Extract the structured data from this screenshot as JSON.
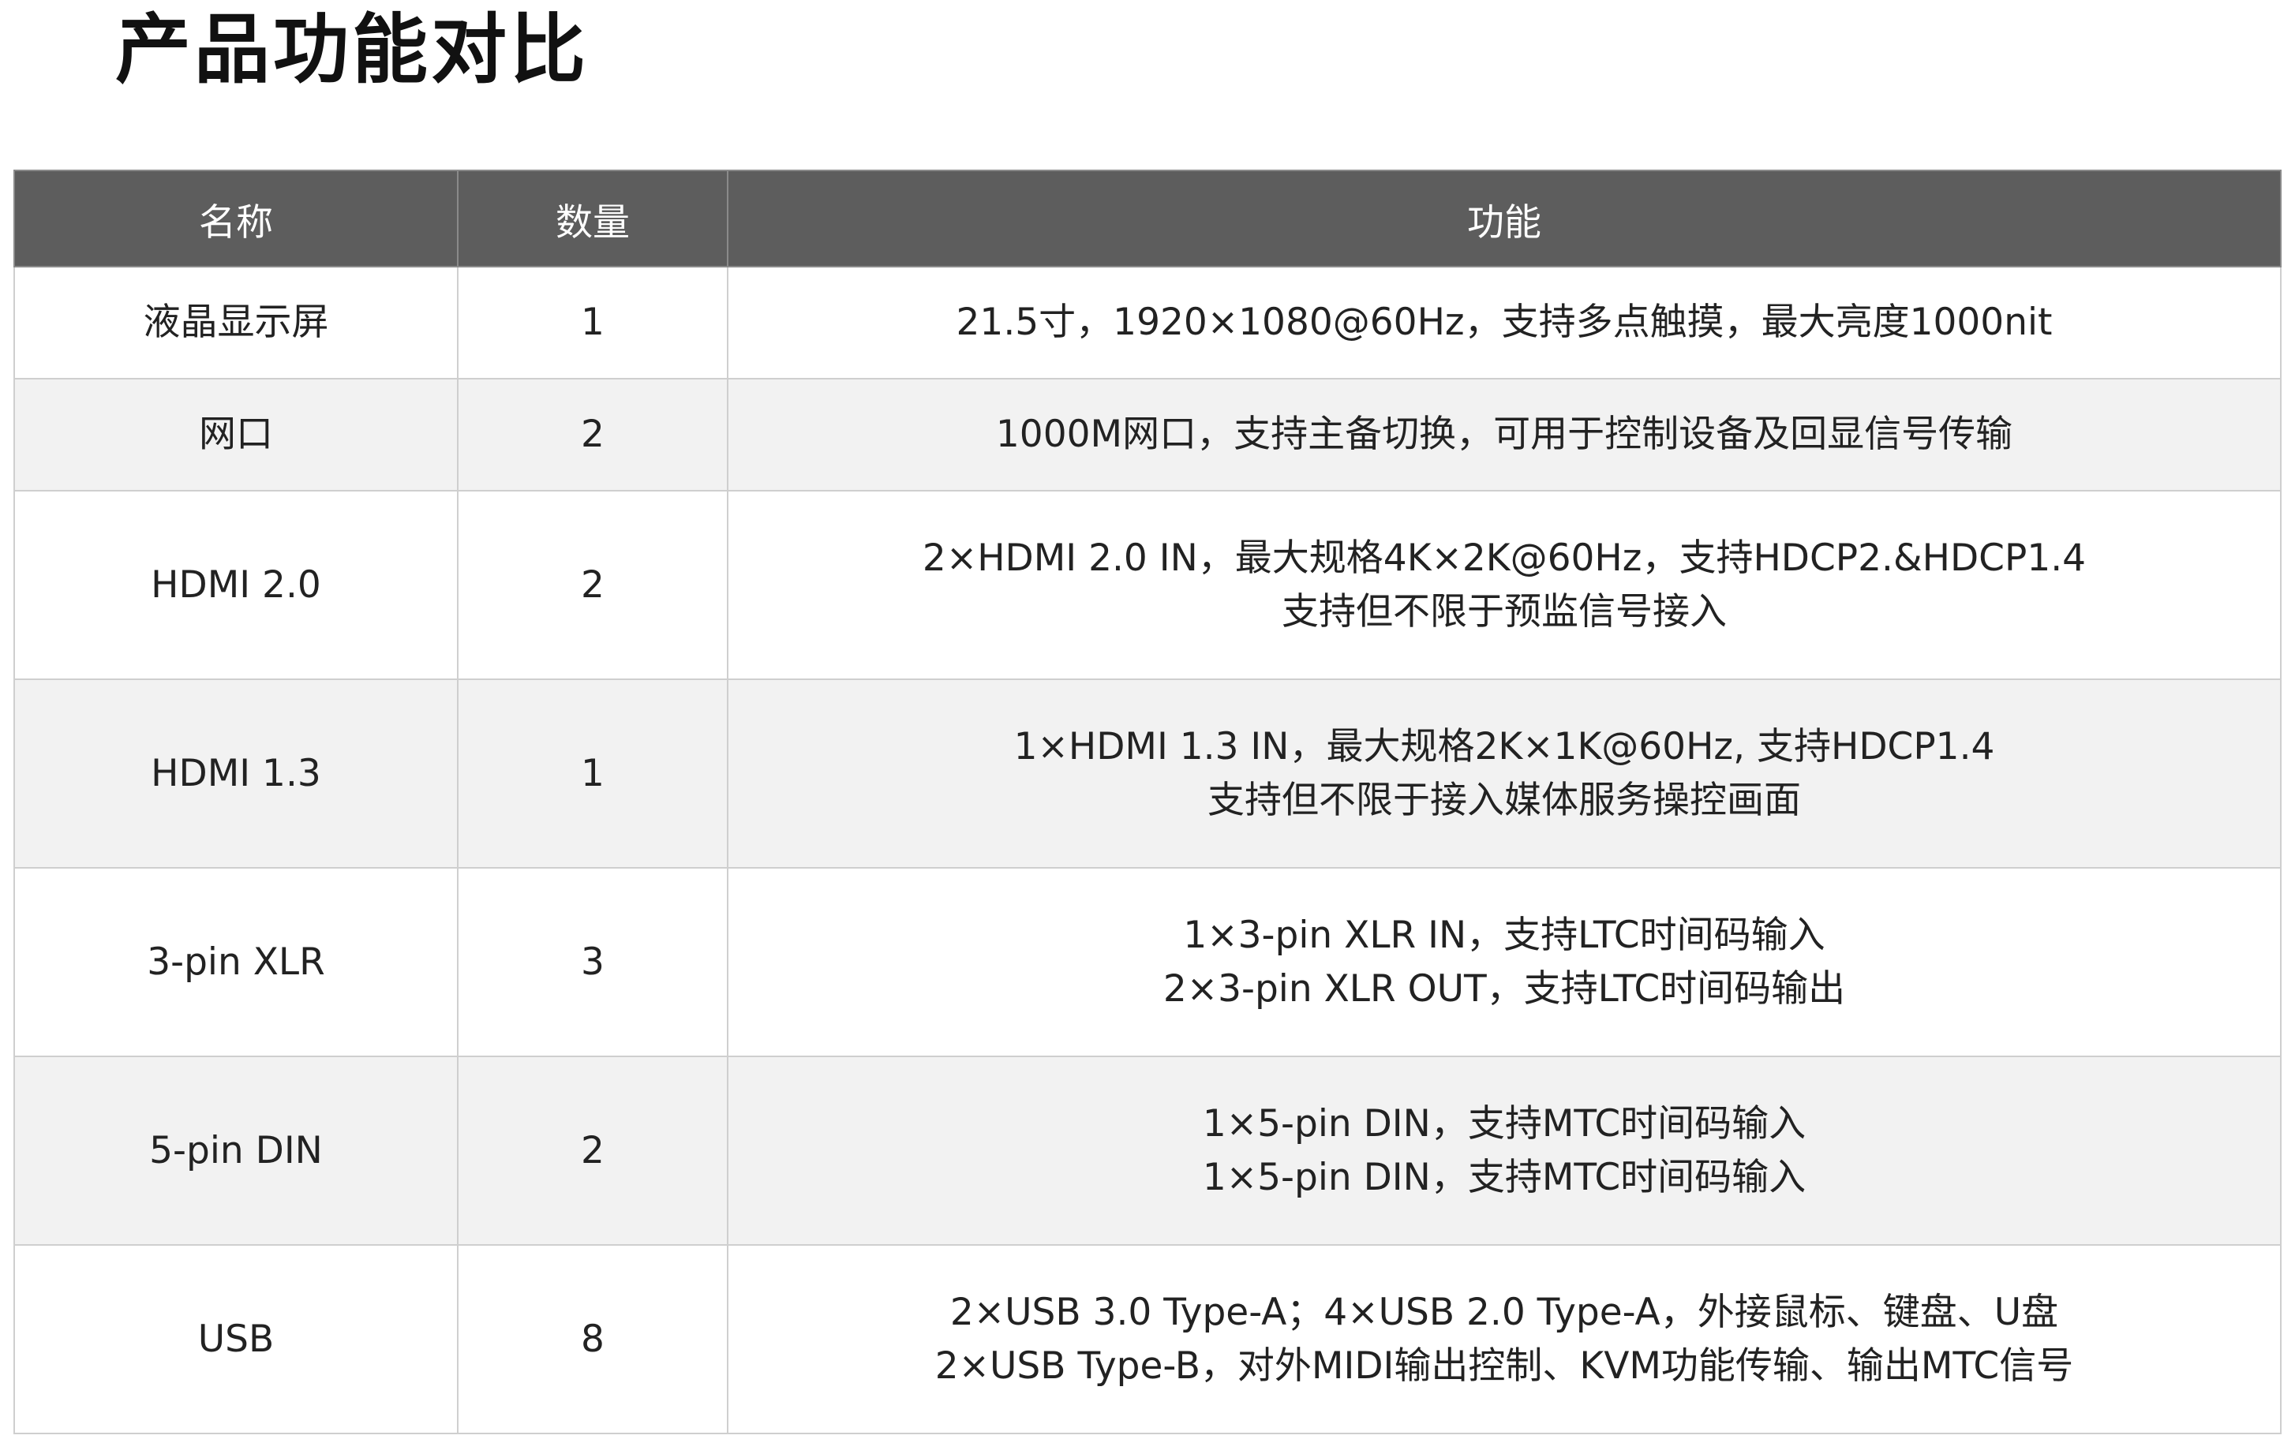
{
  "page": {
    "title": "产品功能对比"
  },
  "table": {
    "headers": {
      "name": "名称",
      "quantity": "数量",
      "function": "功能"
    },
    "rows": [
      {
        "name": "液晶显示屏",
        "quantity": "1",
        "lines": [
          "21.5寸，1920×1080@60Hz，支持多点触摸，最大亮度1000nit"
        ]
      },
      {
        "name": "网口",
        "quantity": "2",
        "lines": [
          "1000M网口，支持主备切换，可用于控制设备及回显信号传输"
        ]
      },
      {
        "name": "HDMI 2.0",
        "quantity": "2",
        "lines": [
          "2×HDMI 2.0 IN，最大规格4K×2K@60Hz，支持HDCP2.&HDCP1.4",
          "支持但不限于预监信号接入"
        ]
      },
      {
        "name": "HDMI 1.3",
        "quantity": "1",
        "lines": [
          "1×HDMI 1.3 IN，最大规格2K×1K@60Hz, 支持HDCP1.4",
          "支持但不限于接入媒体服务操控画面"
        ]
      },
      {
        "name": "3-pin XLR",
        "quantity": "3",
        "lines": [
          "1×3-pin XLR IN，支持LTC时间码输入",
          "2×3-pin XLR OUT，支持LTC时间码输出"
        ]
      },
      {
        "name": "5-pin DIN",
        "quantity": "2",
        "lines": [
          "1×5-pin DIN，支持MTC时间码输入",
          "1×5-pin DIN，支持MTC时间码输入"
        ]
      },
      {
        "name": "USB",
        "quantity": "8",
        "lines": [
          "2×USB 3.0 Type-A；4×USB 2.0 Type-A，外接鼠标、键盘、U盘",
          "2×USB Type-B，对外MIDI输出控制、KVM功能传输、输出MTC信号"
        ]
      }
    ]
  },
  "colors": {
    "header_bg": "#5d5d5d",
    "header_text": "#ffffff",
    "alt_row_bg": "#f2f2f2",
    "border": "#cfcfcf"
  }
}
